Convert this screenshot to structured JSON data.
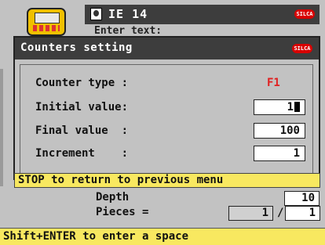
{
  "header": {
    "title": "IE 14",
    "logo_text": "SILCA",
    "behind_text": "Enter text:"
  },
  "dialog": {
    "title": "Counters setting",
    "logo_text": "SILCA",
    "fields": {
      "counter_type": {
        "label": "Counter type :",
        "value": "F1"
      },
      "initial_value": {
        "label": "Initial value:",
        "value": "1"
      },
      "final_value": {
        "label": "Final value  :",
        "value": "100"
      },
      "increment": {
        "label": "Increment    :",
        "value": "1"
      }
    }
  },
  "status": {
    "stop_message": "STOP to return to previous menu",
    "hint": "Shift+ENTER to enter a space"
  },
  "background_fields": {
    "depth": {
      "label": "Depth",
      "value": "10"
    },
    "pieces": {
      "label": "Pieces =",
      "current": "1",
      "separator": "/",
      "total": "1"
    }
  },
  "colors": {
    "title_bar": "#3d3d3d",
    "background": "#c2c2c2",
    "status_bar": "#f8e860",
    "accent_red": "#e02020"
  }
}
